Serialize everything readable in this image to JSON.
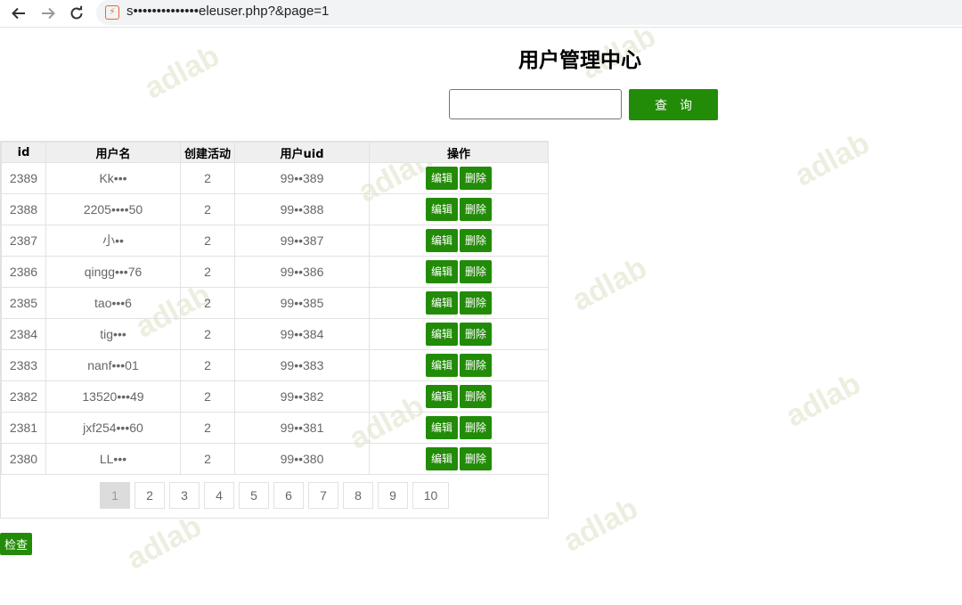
{
  "browser": {
    "url": "s••••••••••••••eleuser.php?&page=1",
    "site_icon": "page-icon"
  },
  "page": {
    "title": "用户管理中心",
    "search_value": "",
    "query_label": "查询"
  },
  "table": {
    "headers": [
      "id",
      "用户名",
      "创建活动",
      "用户uid",
      "操作"
    ],
    "edit_label": "编辑",
    "delete_label": "删除",
    "rows": [
      {
        "id": "2389",
        "name": "Kk•••",
        "activities": "2",
        "uid": "99••389"
      },
      {
        "id": "2388",
        "name": "2205••••50",
        "activities": "2",
        "uid": "99••388"
      },
      {
        "id": "2387",
        "name": "小••",
        "activities": "2",
        "uid": "99••387"
      },
      {
        "id": "2386",
        "name": "qingg•••76",
        "activities": "2",
        "uid": "99••386"
      },
      {
        "id": "2385",
        "name": "tao•••6",
        "activities": "2",
        "uid": "99••385"
      },
      {
        "id": "2384",
        "name": "tig•••",
        "activities": "2",
        "uid": "99••384"
      },
      {
        "id": "2383",
        "name": "nanf•••01",
        "activities": "2",
        "uid": "99••383"
      },
      {
        "id": "2382",
        "name": "13520•••49",
        "activities": "2",
        "uid": "99••382"
      },
      {
        "id": "2381",
        "name": "jxf254•••60",
        "activities": "2",
        "uid": "99••381"
      },
      {
        "id": "2380",
        "name": "LL•••",
        "activities": "2",
        "uid": "99••380"
      }
    ]
  },
  "pagination": {
    "pages": [
      "1",
      "2",
      "3",
      "4",
      "5",
      "6",
      "7",
      "8",
      "9",
      "10"
    ],
    "current": "1"
  },
  "check_label": "检查",
  "watermark_text": "adlab",
  "colors": {
    "accent": "#228b08",
    "header_bg": "#efefef",
    "border": "#e2e2e2"
  }
}
